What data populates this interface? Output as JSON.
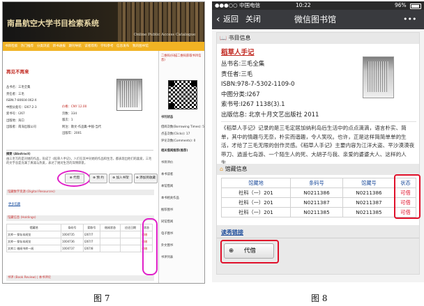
{
  "fig7": {
    "library_title": "南昌航空大学书目检索系统",
    "opac_label": "Online Public Access Catalogue",
    "nav_items": [
      "书目检索",
      "热门推荐",
      "分类浏览",
      "新书通报",
      "期刊导航",
      "读者荐购",
      "学科参考",
      "信息发布",
      "我的图书馆"
    ],
    "book_title": "再见不再来",
    "meta_left": [
      "丛书名：三毛全集",
      "责任者：三毛",
      "ISBN:7-80604-062-X",
      "中图分类号：I267.2-3",
      "索书号：I267",
      "出版地：海口",
      "出版者：南海出版公司"
    ],
    "meta_right": [
      "价格：CNY 12.00",
      "页数：334",
      "版次：1",
      "附注：散文-作品集-中国-当代",
      "出版年：2001"
    ],
    "abstract_label": "摘要 (Abstract)",
    "abstract_text": "由三毛写的是对她的作品，形成了《稻草人手记》，人们在其中对她的作品和生活，都表现出他们的喜爱，三毛的文字总是充满了真诚与热爱，表达了她对生活的深情厚意。",
    "buttons": [
      "代借",
      "预 约",
      "加入书架",
      "添加到收藏"
    ],
    "sec_holdings_digital": "馆藏数字资源 (Digital Resources)",
    "sec_holdings_copies": "馆藏信息 (Holdings)",
    "more_link": "更多馆藏",
    "holdings_headers": [
      "馆藏地",
      "条码号",
      "索取号",
      "借阅状态",
      "应还日期",
      "状态"
    ],
    "holdings_rows": [
      [
        "文库一  保存本阅览",
        "1004735",
        "I267/7",
        "",
        "",
        "可借"
      ],
      [
        "文库一  保存本阅览",
        "1004736",
        "I267/7",
        "",
        "",
        "可借"
      ],
      [
        "文库二  借阅书库一阅",
        "1004737",
        "I267/8",
        "",
        "",
        "可借"
      ]
    ],
    "book_detail_label": "书评 (Book Review) | 本书评论",
    "side_top": "二维码(扫描二维码获取书目信息)",
    "side_items": [
      "书刊状态",
      "借阅次数(Borrowing Times): 5",
      "点击次数(Clicks): 17",
      "评论次数(Comments): 0",
      "相关借阅推荐(推荐)",
      "书目评价",
      "本书读者",
      "本馆借阅",
      "本书相关作品",
      "推荐图书",
      "同馆借阅",
      "电子图书",
      "外文图书",
      "书评列表"
    ]
  },
  "fig8": {
    "status": {
      "carrier": "●●●○○ 中国电信",
      "wifi": "WiFi",
      "time": "10:22",
      "battery": "96%"
    },
    "title": "微信图书馆",
    "back": "返回",
    "close": "关闭",
    "more": "•••",
    "section_info": "书目信息",
    "book_title": "稻草人手记",
    "fields": [
      {
        "label": "丛书名:",
        "value": "三毛全集"
      },
      {
        "label": "责任者:",
        "value": "三毛"
      },
      {
        "label": "ISBN:",
        "value": "978-7-5302-1109-0"
      },
      {
        "label": "中图分类:",
        "value": "I267"
      },
      {
        "label": "索书号:",
        "value": "I267 1138(3).1"
      },
      {
        "label": "出版信息:",
        "value": "北京十月文艺出版社  2011"
      }
    ],
    "summary": "《稻草人手记》记录的是三毛定居加纳利岛后生活中的点点滴滴，语言朴实、简单，其中的情趣与无奈，朴实而谐趣，令人笑叹。也许，正是这样简简单单的生活，才给了三毛无限的创作灵感。《稻草人手记》主要内容为江洋大盗、平沙漠漠夜带刀、逍遥七岛游、一个陌生人的死、大胡子与我、亲爱的婆婆大人、这样的人生……",
    "section_holdings": "馆藏信息",
    "holdings_headers": [
      "馆藏地",
      "条码号",
      "馆藏号",
      "状态"
    ],
    "holdings_rows": [
      [
        "社科（一）201",
        "N0211386",
        "N0211386",
        "可借"
      ],
      [
        "社科（一）201",
        "N0211387",
        "N0211387",
        "可借"
      ],
      [
        "社科（一）201",
        "N0211385",
        "N0211385",
        "可借"
      ]
    ],
    "link_label": "读秀链接",
    "button_label": "代借"
  },
  "captions": {
    "left": "图 7",
    "right": "图 8"
  },
  "colors": {
    "nav_orange": "#f1b324",
    "highlight_magenta": "#e020c8",
    "highlight_red": "#e0102a",
    "wechat_dark": "#393a3e"
  }
}
